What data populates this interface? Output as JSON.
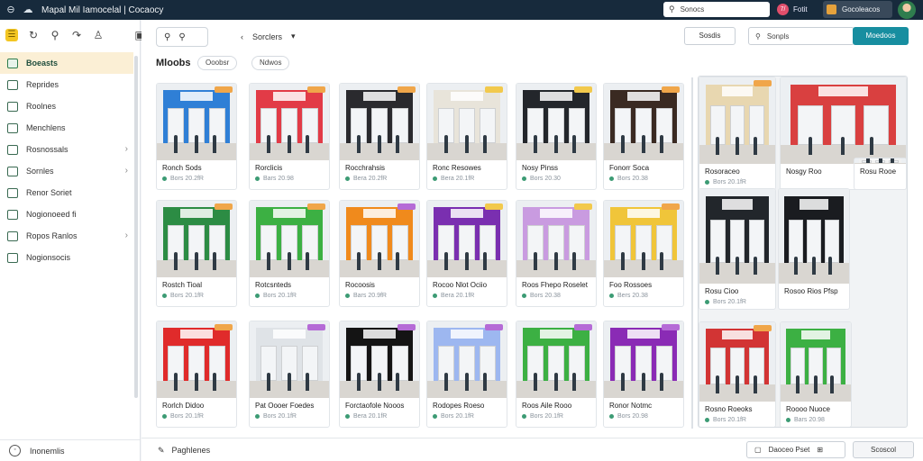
{
  "topbar": {
    "title": "Mapal Mil Iamocelal | Cocaocy",
    "search_text": "Sonocs",
    "user_initials": "7/",
    "user_name": "Fotit",
    "org_name": "Gocoleacos"
  },
  "sidebar": {
    "items": [
      {
        "label": "Boeasts",
        "active": true,
        "chevron": false
      },
      {
        "label": "Reprides",
        "active": false,
        "chevron": false
      },
      {
        "label": "Roolnes",
        "active": false,
        "chevron": false
      },
      {
        "label": "Menchlens",
        "active": false,
        "chevron": false
      },
      {
        "label": "Rosnossals",
        "active": false,
        "chevron": true
      },
      {
        "label": "Sornles",
        "active": false,
        "chevron": true
      },
      {
        "label": "Renor Soriet",
        "active": false,
        "chevron": false
      },
      {
        "label": "Nogionoeed fi",
        "active": false,
        "chevron": false
      },
      {
        "label": "Ropos Ranlos",
        "active": false,
        "chevron": true
      },
      {
        "label": "Nogionsocis",
        "active": false,
        "chevron": false
      }
    ],
    "footer_label": "Inonemlis"
  },
  "toolbar": {
    "breadcrumb": "Sorclers",
    "secondary_button": "Sosdis",
    "search_text": "Sonpls",
    "primary_button": "Moedoos"
  },
  "section": {
    "title": "Mloobs",
    "chip_1": "Ooobsr",
    "chip_2": "Ndwos"
  },
  "cards": [
    {
      "title": "Ronch Sods",
      "meta": "Bors   20.2fR",
      "wall": "#2f7fd6",
      "tag": "#f0a64a"
    },
    {
      "title": "Rorclicis",
      "meta": "Bars   20.98",
      "wall": "#e23b47",
      "tag": "#f0a64a"
    },
    {
      "title": "Rocchrahsis",
      "meta": "Bera   20.2fR",
      "wall": "#2a2a2e",
      "tag": "#f0a64a"
    },
    {
      "title": "Ronc Resowes",
      "meta": "Bera   20.1fR",
      "wall": "#e8e4da",
      "tag": "#f2c94c"
    },
    {
      "title": "Nosy Pinss",
      "meta": "Bors   20.30",
      "wall": "#23262b",
      "tag": "#f2c94c"
    },
    {
      "title": "Fonorr Soca",
      "meta": "Bors   20.38",
      "wall": "#3a2a22",
      "tag": "#f0a64a"
    },
    {
      "title": "Rostch Tioal",
      "meta": "Bors   20.1fR",
      "wall": "#2c8c44",
      "tag": "#f0a64a"
    },
    {
      "title": "Rotcsnteds",
      "meta": "Bors   20.1fR",
      "wall": "#3cb043",
      "tag": "#f0a64a"
    },
    {
      "title": "Rocoosis",
      "meta": "Bars   20.9fR",
      "wall": "#f08a1c",
      "tag": "#b56bd6"
    },
    {
      "title": "Rocoo Nlot Ociio",
      "meta": "Bera   20.1fR",
      "wall": "#7a2fb0",
      "tag": "#f2c94c"
    },
    {
      "title": "Roos Fhepo Roselet",
      "meta": "Bors   20.38",
      "wall": "#c99be0",
      "tag": "#f2c94c"
    },
    {
      "title": "Foo Rossoes",
      "meta": "Bers   20.38",
      "wall": "#f0c53a",
      "tag": "#f0a64a"
    },
    {
      "title": "Rorlch Didoo",
      "meta": "Bors   20.1fR",
      "wall": "#e02b2b",
      "tag": "#f0a64a"
    },
    {
      "title": "Pat Oooer Foedes",
      "meta": "Bors   20.1fR",
      "wall": "#dfe3e7",
      "tag": "#b56bd6"
    },
    {
      "title": "Forctaofole Nooos",
      "meta": "Bera   20.1fR",
      "wall": "#141414",
      "tag": "#b56bd6"
    },
    {
      "title": "Rodopes Roeso",
      "meta": "Bors   20.1fR",
      "wall": "#9db7f0",
      "tag": "#b56bd6"
    },
    {
      "title": "Roos Aile Rooo",
      "meta": "Bors   20.1fR",
      "wall": "#3cb043",
      "tag": "#b56bd6"
    },
    {
      "title": "Ronor Notmc",
      "meta": "Bors   20.98",
      "wall": "#8a2bb5",
      "tag": "#b56bd6"
    }
  ],
  "big_panel": {
    "cards": [
      {
        "title": "Rosoraceo",
        "meta": "Bors   20.1fR",
        "wall": "#e8d7b0"
      },
      {
        "title": "Nosgy Roo",
        "meta": "",
        "wall": "#d94040"
      },
      {
        "title": "Rosu Rooe",
        "meta": "",
        "wall": "#f1f1f1"
      },
      {
        "title": "Rosu Cioo",
        "meta": "Bors   20.1fR",
        "wall": "#22262b"
      },
      {
        "title": "Rosoo Rios Pfsp",
        "meta": "",
        "wall": "#1a1c20"
      },
      {
        "title": "Rosno Roeoks",
        "meta": "Bors   20.1fR",
        "wall": "#d23434"
      },
      {
        "title": "Roooo Nuoce",
        "meta": "Bars   20.98",
        "wall": "#3cb043"
      }
    ]
  },
  "bottombar": {
    "left_label": "Paghlenes",
    "right_label": "Daoceo Pset",
    "right_button": "Scoscol"
  }
}
